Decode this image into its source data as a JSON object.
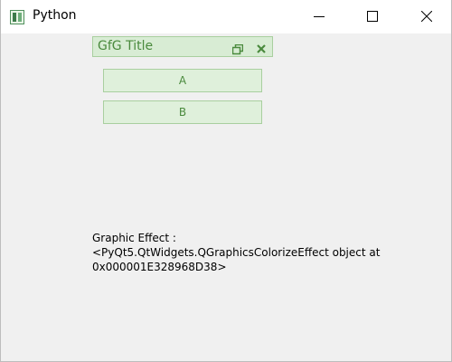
{
  "window": {
    "title": "Python",
    "icon": "python-app-icon",
    "controls": {
      "minimize": "minimize-icon",
      "maximize": "maximize-icon",
      "close": "close-icon"
    }
  },
  "sub_window": {
    "title": "GfG Title",
    "restore_icon": "restore-icon",
    "close_icon": "close-icon"
  },
  "buttons": {
    "a_label": "A",
    "b_label": "B"
  },
  "graphic_effect": {
    "text": "Graphic Effect :\n<PyQt5.QtWidgets.QGraphicsColorizeEffect object at\n0x000001E328968D38>"
  },
  "colors": {
    "tint_fill": "#d8ecd4",
    "tint_border": "#a9cf9f",
    "tint_text": "#4a8a3d"
  }
}
